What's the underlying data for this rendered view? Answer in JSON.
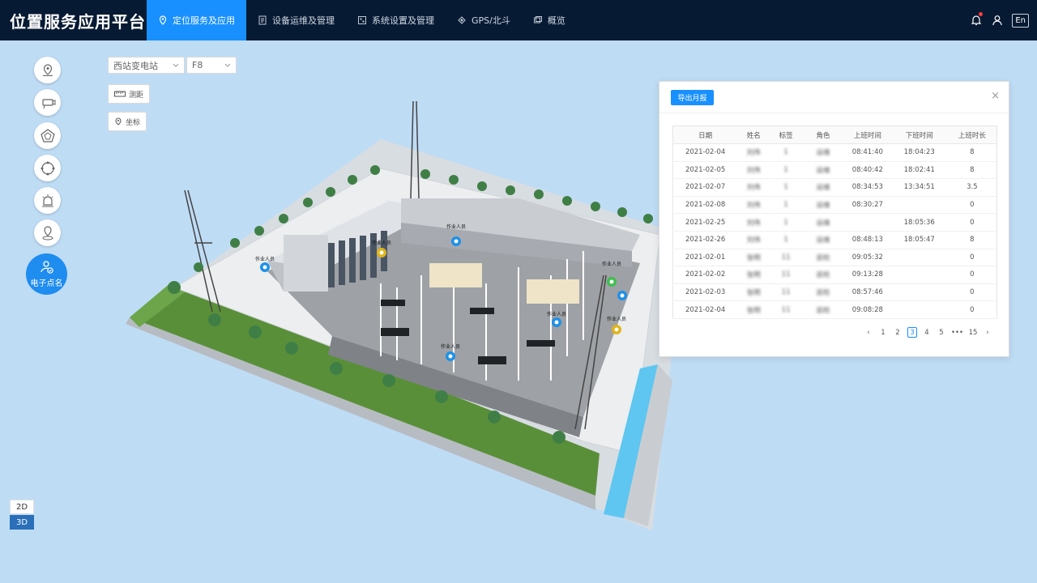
{
  "app": {
    "title": "位置服务应用平台"
  },
  "nav": [
    {
      "label": "定位服务及应用",
      "icon": "location-icon",
      "active": true
    },
    {
      "label": "设备运维及管理",
      "icon": "document-icon",
      "active": false
    },
    {
      "label": "系统设置及管理",
      "icon": "grid-icon",
      "active": false
    },
    {
      "label": "GPS/北斗",
      "icon": "satellite-icon",
      "active": false
    },
    {
      "label": "概览",
      "icon": "overview-icon",
      "active": false
    }
  ],
  "top_right": {
    "lang": "En"
  },
  "sidebar": {
    "active_label": "电子点名"
  },
  "filters": {
    "station": "西站变电站",
    "floor": "F8"
  },
  "tools": {
    "measure": "测距",
    "coord": "坐标"
  },
  "view": {
    "two_d": "2D",
    "three_d": "3D"
  },
  "panel": {
    "export_label": "导出月报",
    "close": "×",
    "columns": [
      "日期",
      "姓名",
      "标签",
      "角色",
      "上班时间",
      "下班时间",
      "上班时长"
    ],
    "rows": [
      [
        "2021-02-04",
        "刘伟",
        "1",
        "运维",
        "08:41:40",
        "18:04:23",
        "8"
      ],
      [
        "2021-02-05",
        "刘伟",
        "1",
        "运维",
        "08:40:42",
        "18:02:41",
        "8"
      ],
      [
        "2021-02-07",
        "刘伟",
        "1",
        "运维",
        "08:34:53",
        "13:34:51",
        "3.5"
      ],
      [
        "2021-02-08",
        "刘伟",
        "1",
        "运维",
        "08:30:27",
        "",
        "0"
      ],
      [
        "2021-02-25",
        "刘伟",
        "1",
        "运维",
        "",
        "18:05:36",
        "0"
      ],
      [
        "2021-02-26",
        "刘伟",
        "1",
        "运维",
        "08:48:13",
        "18:05:47",
        "8"
      ],
      [
        "2021-02-01",
        "张明",
        "11",
        "巡检",
        "09:05:32",
        "",
        "0"
      ],
      [
        "2021-02-02",
        "张明",
        "11",
        "巡检",
        "09:13:28",
        "",
        "0"
      ],
      [
        "2021-02-03",
        "张明",
        "11",
        "巡检",
        "08:57:46",
        "",
        "0"
      ],
      [
        "2021-02-04",
        "张明",
        "11",
        "巡检",
        "09:08:28",
        "",
        "0"
      ]
    ],
    "pagination": {
      "pages": [
        "1",
        "2",
        "3",
        "4",
        "5",
        "•••",
        "15"
      ],
      "current": "3",
      "prev": "‹",
      "next": "›"
    }
  },
  "map_labels": {
    "worker": "作业人员"
  },
  "colors": {
    "accent": "#1890ff",
    "topbar": "#071a33",
    "background": "#bfdcf5"
  }
}
